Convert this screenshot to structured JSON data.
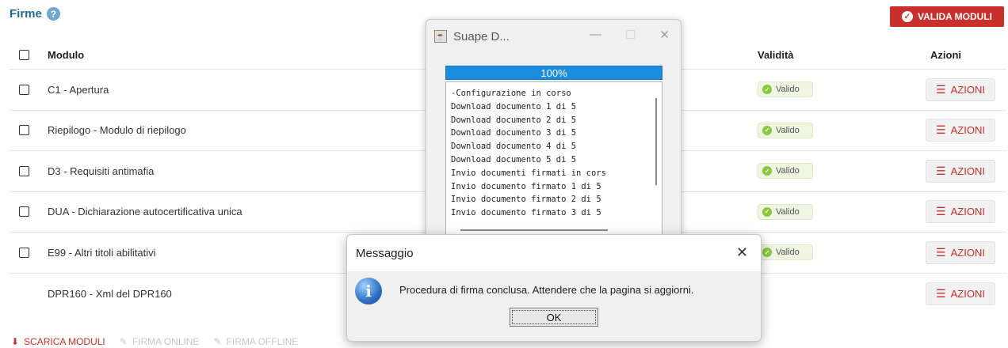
{
  "page": {
    "title": "Firme",
    "help_icon": "?",
    "valida_button": "VALIDA MODULI"
  },
  "table": {
    "headers": {
      "modulo": "Modulo",
      "validita": "Validità",
      "azioni": "Azioni"
    },
    "rows": [
      {
        "modulo": "C1 - Apertura",
        "validita": "Valido",
        "azioni": "AZIONI",
        "checkbox": true
      },
      {
        "modulo": "Riepilogo - Modulo di riepilogo",
        "validita": "Valido",
        "azioni": "AZIONI",
        "checkbox": true
      },
      {
        "modulo": "D3 - Requisiti antimafia",
        "validita": "Valido",
        "azioni": "AZIONI",
        "checkbox": true
      },
      {
        "modulo": "DUA - Dichiarazione autocertificativa unica",
        "validita": "Valido",
        "azioni": "AZIONI",
        "checkbox": true
      },
      {
        "modulo": "E99 - Altri titoli abilitativi",
        "validita": "Valido",
        "azioni": "AZIONI",
        "checkbox": true
      },
      {
        "modulo": "DPR160 - Xml del DPR160",
        "validita": "",
        "azioni": "AZIONI",
        "checkbox": false
      }
    ]
  },
  "bottom_bar": {
    "scarica": "SCARICA MODULI",
    "firma_online": "FIRMA ONLINE",
    "firma_offline": "FIRMA OFFLINE"
  },
  "suape_window": {
    "title": "Suape D...",
    "progress_label": "100%",
    "progress_value": 1.0,
    "log": [
      "-Configurazione in corso",
      "Download documento 1 di 5",
      "Download documento 2 di 5",
      "Download documento 3 di 5",
      "Download documento 4 di 5",
      "Download documento 5 di 5",
      "Invio documenti firmati in cors",
      "Invio documento firmato 1 di 5",
      "Invio documento firmato 2 di 5",
      "Invio documento firmato 3 di 5"
    ]
  },
  "message_dialog": {
    "title": "Messaggio",
    "text": "Procedura di firma conclusa. Attendere che la pagina si aggiorni.",
    "ok_label": "OK",
    "icon": "info-icon"
  },
  "colors": {
    "accent_red": "#c9302c",
    "title_blue": "#1f6c93",
    "progress_blue": "#1c8cdc",
    "valid_green": "#8dc63f"
  }
}
